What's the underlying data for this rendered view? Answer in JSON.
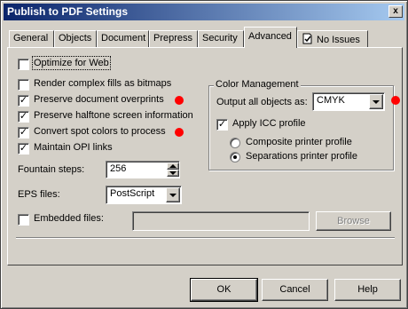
{
  "window": {
    "title": "Publish to PDF Settings",
    "close_glyph": "x"
  },
  "tabs": [
    {
      "label": "General"
    },
    {
      "label": "Objects"
    },
    {
      "label": "Document"
    },
    {
      "label": "Prepress"
    },
    {
      "label": "Security"
    },
    {
      "label": "Advanced",
      "active": true
    },
    {
      "label": "No Issues",
      "icon": "document-check-icon"
    }
  ],
  "options": {
    "optimize_web": {
      "label": "Optimize for Web",
      "checked": false
    },
    "render_complex": {
      "label": "Render complex fills as bitmaps",
      "checked": false
    },
    "preserve_overprints": {
      "label": "Preserve document overprints",
      "checked": true
    },
    "preserve_halftone": {
      "label": "Preserve halftone screen information",
      "checked": true
    },
    "convert_spot": {
      "label": "Convert spot colors to process",
      "checked": true
    },
    "maintain_opi": {
      "label": "Maintain OPI links",
      "checked": true
    }
  },
  "fountain": {
    "label": "Fountain steps:",
    "value": "256"
  },
  "eps": {
    "label": "EPS files:",
    "value": "PostScript"
  },
  "embedded": {
    "label": "Embedded files:",
    "checked": false,
    "value": "",
    "browse_label": "Browse"
  },
  "color_management": {
    "title": "Color Management",
    "output_label": "Output all objects as:",
    "output_value": "CMYK",
    "apply_icc": {
      "label": "Apply ICC profile",
      "checked": true
    },
    "composite": {
      "label": "Composite printer profile",
      "selected": false
    },
    "separations": {
      "label": "Separations printer profile",
      "selected": true
    }
  },
  "buttons": {
    "ok": "OK",
    "cancel": "Cancel",
    "help": "Help"
  },
  "colors": {
    "marker": "#ff0000",
    "title_start": "#0a246a",
    "title_end": "#a6caf0",
    "face": "#d4d0c8"
  }
}
